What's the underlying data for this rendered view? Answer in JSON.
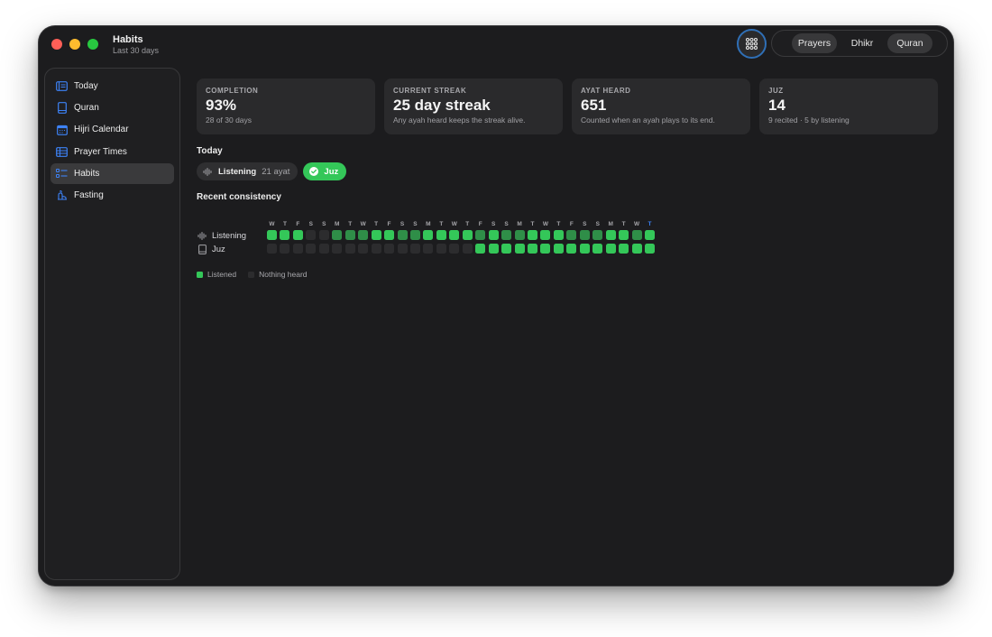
{
  "window": {
    "title": "Habits",
    "subtitle": "Last 30 days"
  },
  "segmented": [
    {
      "label": "Prayers",
      "selected": true
    },
    {
      "label": "Dhikr",
      "selected": false
    },
    {
      "label": "Quran",
      "selected": true
    }
  ],
  "sidebar": {
    "items": [
      {
        "label": "Today",
        "icon": "today-icon",
        "active": false
      },
      {
        "label": "Quran",
        "icon": "book-icon",
        "active": false
      },
      {
        "label": "Hijri Calendar",
        "icon": "calendar-icon",
        "active": false
      },
      {
        "label": "Prayer Times",
        "icon": "table-icon",
        "active": false
      },
      {
        "label": "Habits",
        "icon": "checklist-icon",
        "active": true
      },
      {
        "label": "Fasting",
        "icon": "fasting-icon",
        "active": false
      }
    ]
  },
  "cards": [
    {
      "label": "COMPLETION",
      "value": "93%",
      "sub": "28 of 30 days"
    },
    {
      "label": "CURRENT STREAK",
      "value": "25 day streak",
      "sub": "Any ayah heard keeps the streak alive."
    },
    {
      "label": "AYAT HEARD",
      "value": "651",
      "sub": "Counted when an ayah plays to its end."
    },
    {
      "label": "JUZ",
      "value": "14",
      "sub": "9 recited · 5 by listening"
    }
  ],
  "today": {
    "title": "Today",
    "chips": [
      {
        "label": "Listening",
        "count": "21 ayat",
        "done": false
      },
      {
        "label": "Juz",
        "count": "",
        "done": true
      }
    ]
  },
  "recent": {
    "title": "Recent consistency",
    "days": [
      "W",
      "T",
      "F",
      "S",
      "S",
      "M",
      "T",
      "W",
      "T",
      "F",
      "S",
      "S",
      "M",
      "T",
      "W",
      "T",
      "F",
      "S",
      "S",
      "M",
      "T",
      "W",
      "T",
      "F",
      "S",
      "S",
      "M",
      "T",
      "W",
      "T"
    ],
    "today_index": 29,
    "rows": [
      {
        "label": "Listening",
        "icon": "waveform-icon",
        "cells": [
          1,
          1,
          1,
          0,
          0,
          2,
          2,
          2,
          1,
          1,
          2,
          2,
          1,
          1,
          1,
          1,
          2,
          1,
          2,
          2,
          1,
          1,
          1,
          2,
          2,
          2,
          1,
          1,
          2,
          1
        ]
      },
      {
        "label": "Juz",
        "icon": "book-icon",
        "cells": [
          0,
          0,
          0,
          0,
          0,
          0,
          0,
          0,
          0,
          0,
          0,
          0,
          0,
          0,
          0,
          0,
          1,
          1,
          1,
          1,
          1,
          1,
          1,
          1,
          1,
          1,
          1,
          1,
          1,
          1
        ]
      }
    ],
    "colors": {
      "empty": "#2c2c2e",
      "bright": "#34c759",
      "dim": "#2f8e48"
    }
  },
  "legend": [
    {
      "label": "Listened",
      "color": "#34c759"
    },
    {
      "label": "Nothing heard",
      "color": "#2c2c2e"
    }
  ]
}
